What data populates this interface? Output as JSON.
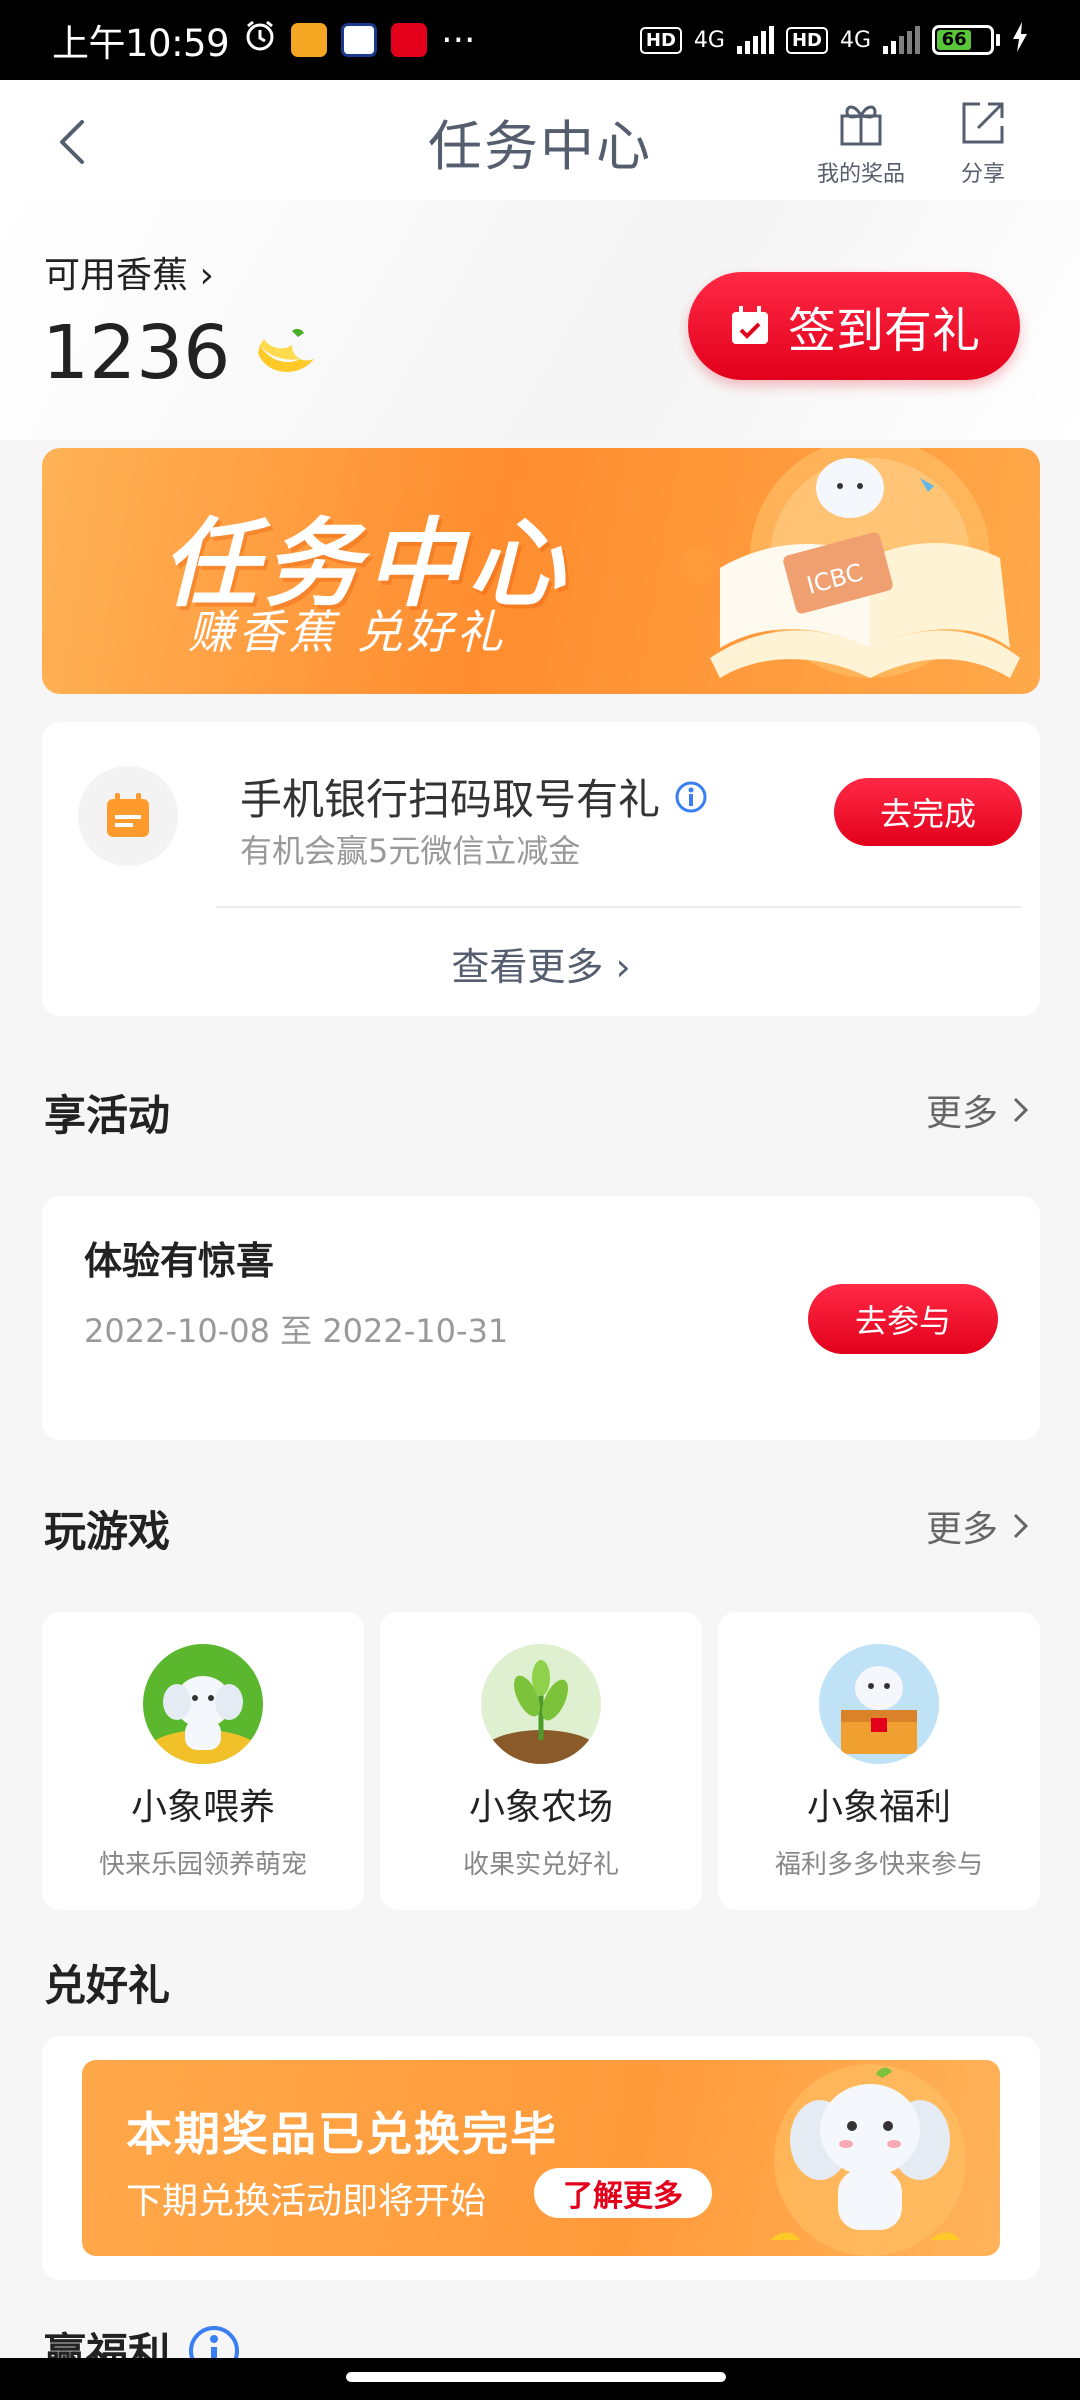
{
  "status_bar": {
    "time": "上午10:59",
    "more": "···",
    "network1": "4G",
    "network2": "4G",
    "hd": "HD",
    "battery": "66"
  },
  "header": {
    "title": "任务中心",
    "my_prize": "我的奖品",
    "share": "分享"
  },
  "banana": {
    "label": "可用香蕉 ›",
    "count": "1236",
    "checkin_label": "签到有礼"
  },
  "hero": {
    "title": "任务中心",
    "subtitle": "赚香蕉 兑好礼",
    "badge": "ICBC"
  },
  "task": {
    "title": "手机银行扫码取号有礼",
    "subtitle": "有机会赢5元微信立减金",
    "button": "去完成",
    "see_more": "查看更多 ›"
  },
  "activities": {
    "section_title": "享活动",
    "more": "更多",
    "items": [
      {
        "title": "体验有惊喜",
        "date": "2022-10-08 至 2022-10-31",
        "button": "去参与"
      }
    ]
  },
  "games": {
    "section_title": "玩游戏",
    "more": "更多",
    "items": [
      {
        "name": "小象喂养",
        "desc": "快来乐园领养萌宠"
      },
      {
        "name": "小象农场",
        "desc": "收果实兑好礼"
      },
      {
        "name": "小象福利",
        "desc": "福利多多快来参与"
      }
    ]
  },
  "gifts": {
    "section_title": "兑好礼",
    "title": "本期奖品已兑换完毕",
    "subtitle": "下期兑换活动即将开始",
    "button": "了解更多"
  },
  "welfare": {
    "section_title": "赢福利"
  },
  "colors": {
    "accent_red": "#e2001b",
    "banner_orange": "#ff8d2f",
    "text_gray": "#555e6e"
  }
}
